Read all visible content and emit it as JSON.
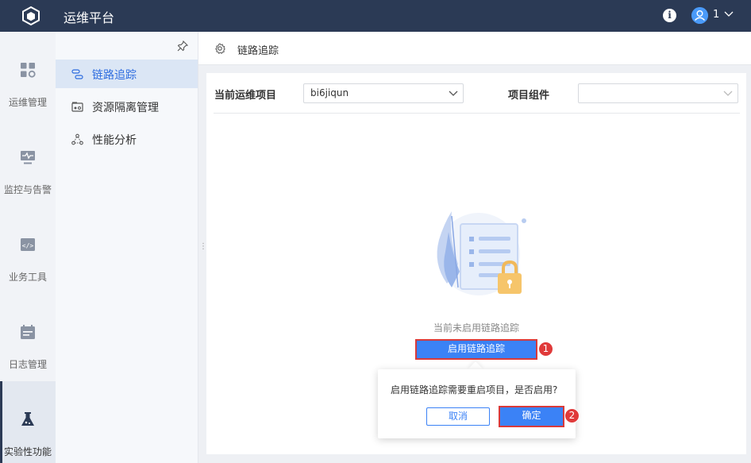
{
  "header": {
    "app_title": "运维平台",
    "user_label": "1",
    "icons": {
      "logo": "cube-logo-icon",
      "info": "info-icon",
      "avatar": "user-avatar-icon",
      "dropdown": "chevron-down-icon"
    }
  },
  "rail": {
    "items": [
      {
        "label": "运维管理",
        "icon": "grid-settings-icon"
      },
      {
        "label": "监控与告警",
        "icon": "monitor-icon"
      },
      {
        "label": "业务工具",
        "icon": "code-window-icon"
      },
      {
        "label": "日志管理",
        "icon": "calendar-log-icon"
      },
      {
        "label": "实验性功能",
        "icon": "flask-icon"
      }
    ],
    "active_index": 4
  },
  "sidemenu": {
    "items": [
      {
        "label": "链路追踪",
        "icon": "trace-link-icon"
      },
      {
        "label": "资源隔离管理",
        "icon": "resource-isolation-icon"
      },
      {
        "label": "性能分析",
        "icon": "performance-nodes-icon"
      }
    ],
    "active_index": 0
  },
  "content": {
    "header_title": "链路追踪",
    "filters": {
      "project_label": "当前运维项目",
      "project_value": "bi6jiqun",
      "component_label": "项目组件",
      "component_value": ""
    },
    "empty_text": "当前未启用链路追踪",
    "enable_button": "启用链路追踪"
  },
  "popconfirm": {
    "message": "启用链路追踪需要重启项目，是否启用?",
    "cancel": "取消",
    "ok": "确定"
  },
  "badges": {
    "first": "1",
    "second": "2"
  },
  "colors": {
    "topbar": "#2b3a55",
    "primary": "#3b82f6",
    "highlight": "#d93a3a",
    "active_menu_bg": "#dbe6f5"
  }
}
